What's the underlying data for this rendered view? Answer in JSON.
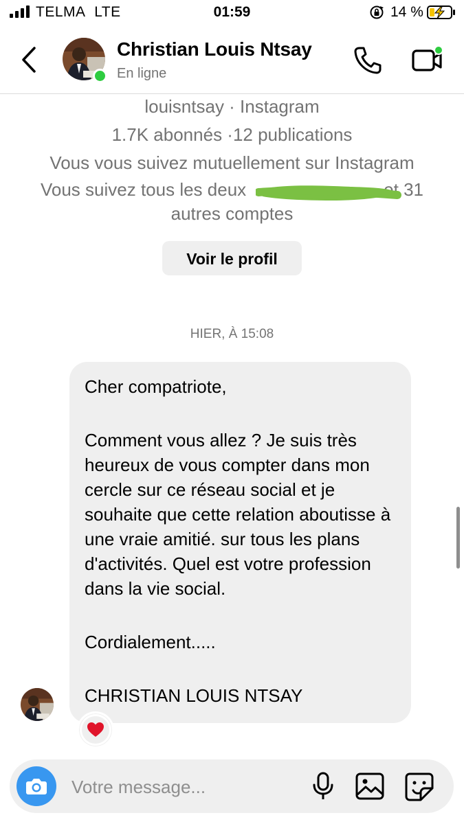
{
  "status_bar": {
    "carrier": "TELMA",
    "network": "LTE",
    "time": "01:59",
    "battery_pct": "14 %",
    "icons": [
      "signal-icon",
      "orientation-lock-icon",
      "battery-charging-icon"
    ]
  },
  "header": {
    "name": "Christian Louis Ntsay",
    "status": "En ligne",
    "icons": [
      "back-icon",
      "phone-icon",
      "video-icon"
    ]
  },
  "profile": {
    "handle_line": "louisntsay · Instagram",
    "stats_line": "1.7K abonnés ·12 publications",
    "mutual_line": "Vous vous suivez mutuellement sur Instagram",
    "common_line_1": "Vous suivez tous les deux",
    "common_line_1_end": "et 31",
    "common_line_2": "autres comptes",
    "view_profile": "Voir le profil"
  },
  "thread": {
    "timestamp": "HIER, À 15:08",
    "message": {
      "greeting": "Cher compatriote,",
      "body": "Comment vous allez ? Je suis très heureux de vous compter dans mon cercle sur ce réseau social et je souhaite que cette relation aboutisse à une vraie amitié. sur tous les plans d'activités. Quel est votre profession dans la vie social.",
      "closing": "Cordialement.....",
      "signature": "CHRISTIAN LOUIS NTSAY"
    },
    "reaction": "❤️"
  },
  "composer": {
    "placeholder": "Votre message...",
    "icons": [
      "camera-icon",
      "microphone-icon",
      "gallery-icon",
      "sticker-icon"
    ]
  },
  "colors": {
    "accent": "#3897f0",
    "online": "#2ecc40",
    "bubble": "#efefef",
    "secondary_text": "#737373",
    "redaction": "#7bc043"
  }
}
